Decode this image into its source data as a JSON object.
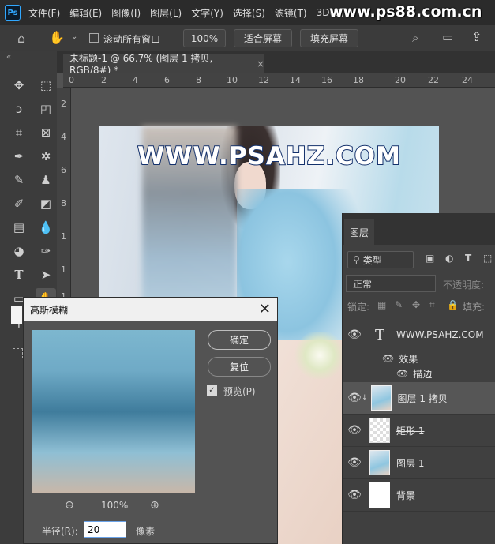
{
  "menubar": {
    "logo": "Ps",
    "items": [
      "文件(F)",
      "编辑(E)",
      "图像(I)",
      "图层(L)",
      "文字(Y)",
      "选择(S)",
      "滤镜(T)",
      "3D(D)"
    ],
    "watermark": "www.ps88.com.cn"
  },
  "options": {
    "scroll_all_label": "滚动所有窗口",
    "zoom_value": "100%",
    "fit_screen": "适合屏幕",
    "fill_screen": "填充屏幕"
  },
  "document": {
    "tab_title": "未标题-1 @ 66.7% (图层 1 拷贝, RGB/8#) *",
    "close_glyph": "×",
    "canvas_text": "WWW.PSAHZ.COM"
  },
  "ruler": {
    "top_ticks": [
      "0",
      "2",
      "4",
      "6",
      "8",
      "10",
      "12",
      "14",
      "16",
      "18",
      "20",
      "22",
      "24"
    ],
    "left_ticks": [
      "2",
      "4",
      "6",
      "8",
      "1",
      "1",
      "1"
    ]
  },
  "layers_panel": {
    "tab": "图层",
    "filter_label": "类型",
    "blend_mode": "正常",
    "opacity_label": "不透明度:",
    "lock_label": "锁定:",
    "fill_label": "填充:",
    "layers": [
      {
        "name": "WWW.PSAHZ.COM",
        "kind": "text"
      },
      {
        "name": "效果",
        "kind": "effects"
      },
      {
        "name": "描边",
        "kind": "effect-item"
      },
      {
        "name": "图层 1 拷贝",
        "kind": "image",
        "selected": true
      },
      {
        "name": "矩形 1",
        "kind": "shape"
      },
      {
        "name": "图层 1",
        "kind": "image"
      },
      {
        "name": "背景",
        "kind": "background"
      }
    ]
  },
  "dialog": {
    "title": "高斯模糊",
    "ok": "确定",
    "reset": "复位",
    "preview_label": "预览(P)",
    "preview_checked": true,
    "zoom_value": "100%",
    "radius_label": "半径(R):",
    "radius_value": "20",
    "unit": "像素"
  }
}
